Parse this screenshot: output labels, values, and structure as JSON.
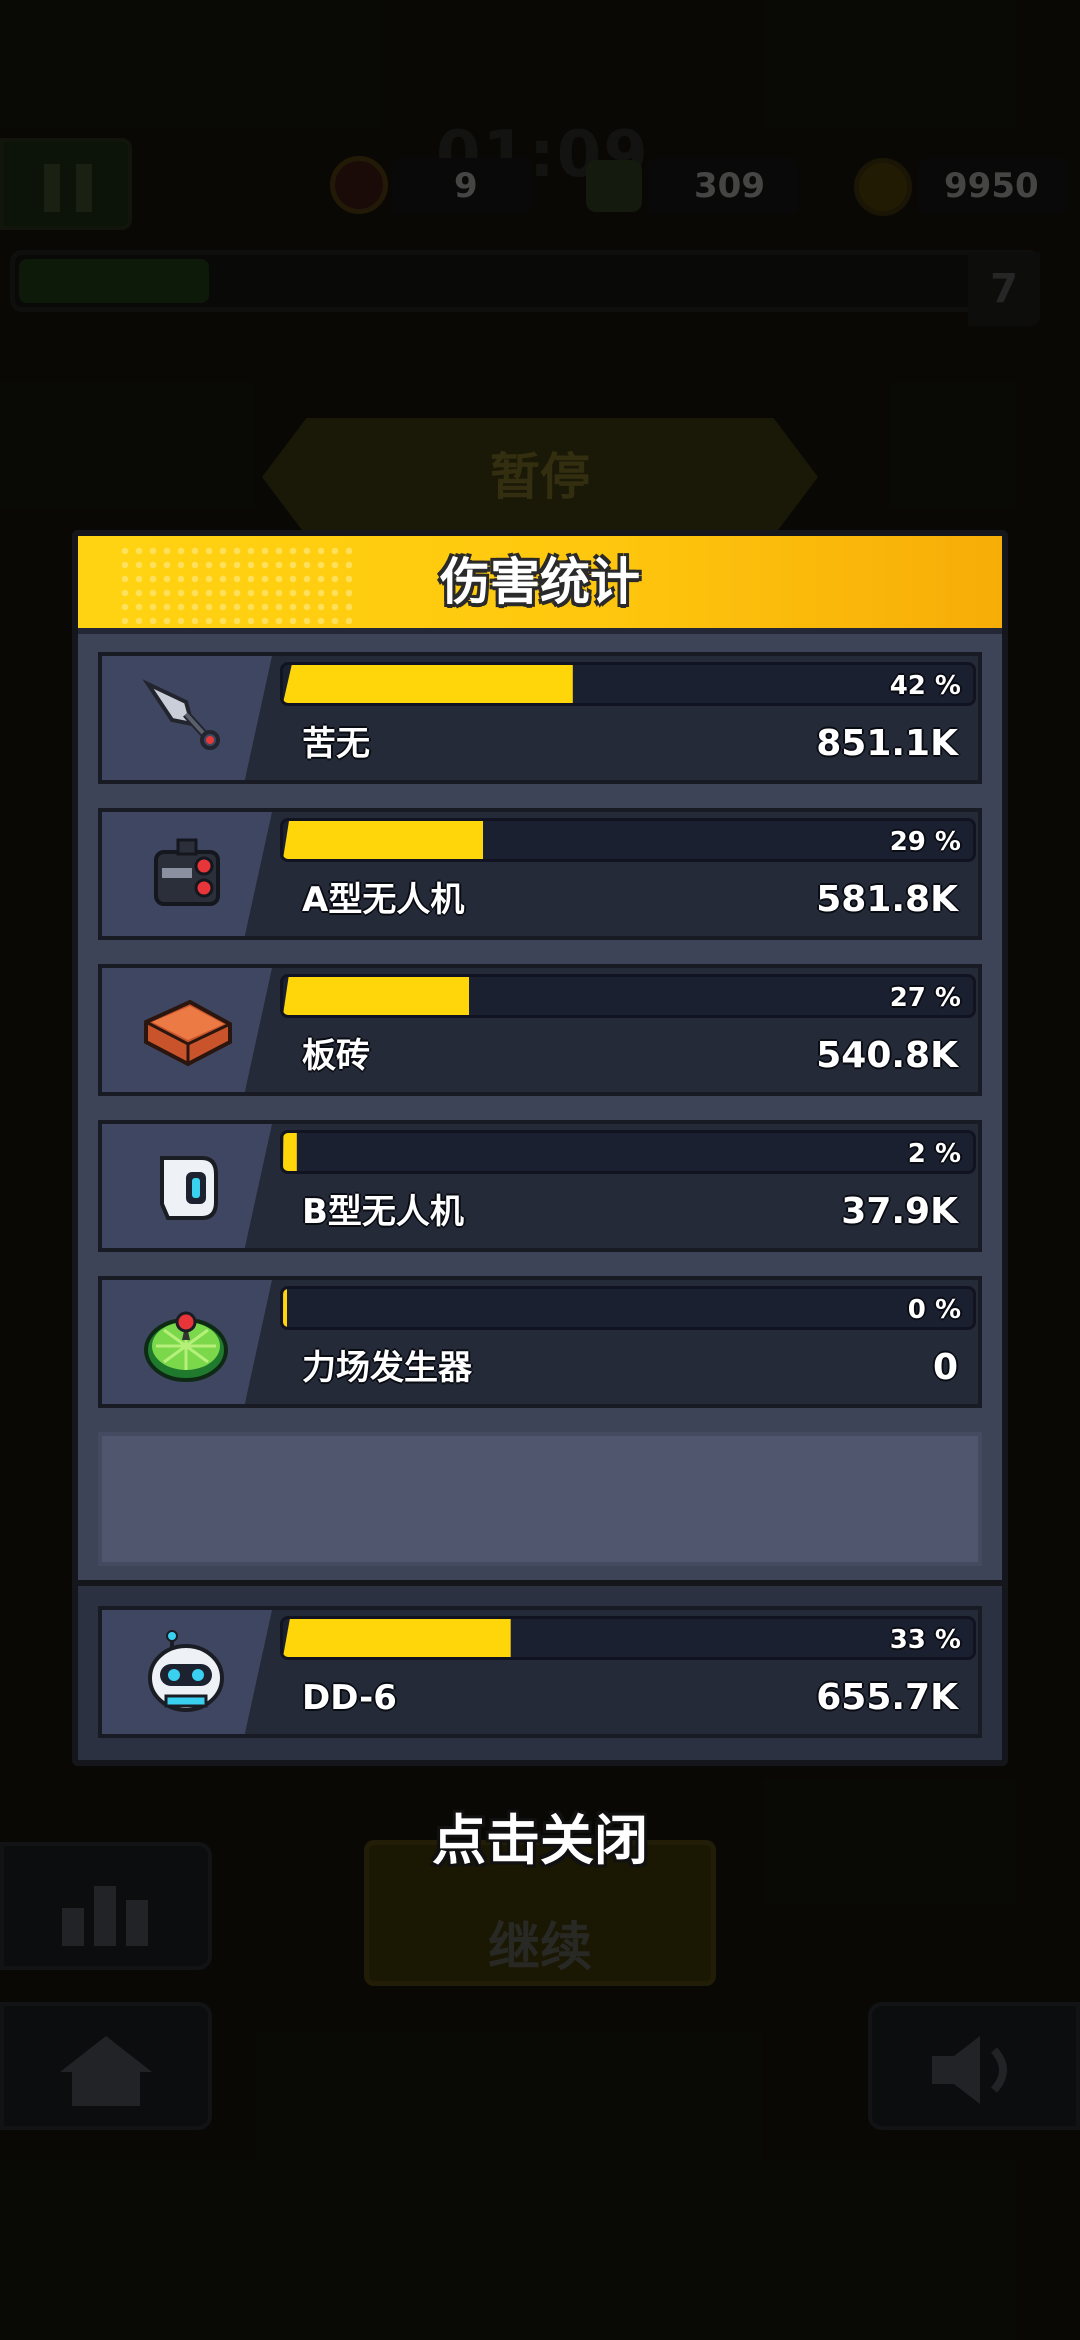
{
  "hud": {
    "timer": "01:09",
    "hearts": "9",
    "kills": "309",
    "coins": "9950",
    "level": "7"
  },
  "background": {
    "pause_banner": "暂停",
    "continue_button": "继续"
  },
  "dialog": {
    "title": "伤害统计",
    "weapons": [
      {
        "name": "苦无",
        "damage": "851.1K",
        "percent_label": "42 %",
        "percent": 42,
        "icon": "kunai-icon"
      },
      {
        "name": "A型无人机",
        "damage": "581.8K",
        "percent_label": "29 %",
        "percent": 29,
        "icon": "drone-a-icon"
      },
      {
        "name": "板砖",
        "damage": "540.8K",
        "percent_label": "27 %",
        "percent": 27,
        "icon": "brick-icon"
      },
      {
        "name": "B型无人机",
        "damage": "37.9K",
        "percent_label": "2 %",
        "percent": 2,
        "icon": "drone-b-icon"
      },
      {
        "name": "力场发生器",
        "damage": "0",
        "percent_label": "0 %",
        "percent": 0,
        "icon": "force-field-icon"
      }
    ],
    "character": {
      "name": "DD-6",
      "damage": "655.7K",
      "percent_label": "33 %",
      "percent": 33,
      "icon": "robot-dd6-icon"
    }
  },
  "close_hint": "点击关闭",
  "colors": {
    "accent_yellow": "#ffd60a",
    "header_orange": "#f7ad07",
    "panel_bg": "#3e4458",
    "row_bg": "#252a38"
  }
}
